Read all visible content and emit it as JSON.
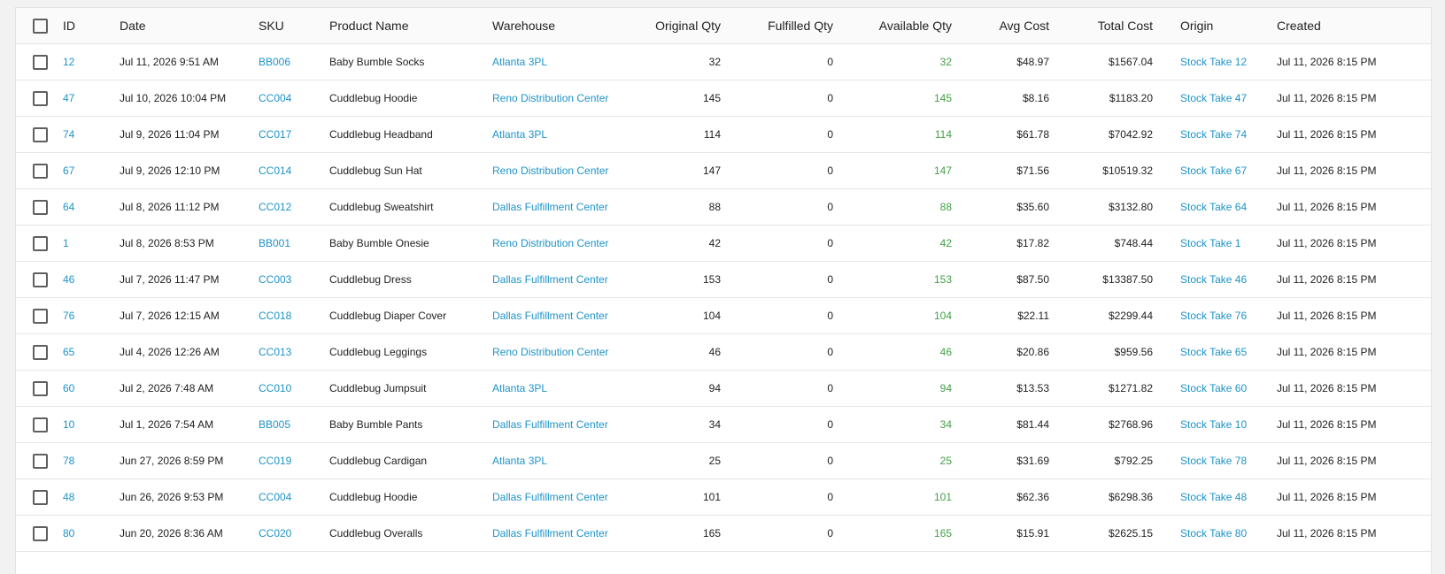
{
  "columns": {
    "id": "ID",
    "date": "Date",
    "sku": "SKU",
    "product": "Product Name",
    "warehouse": "Warehouse",
    "original": "Original Qty",
    "fulfilled": "Fulfilled Qty",
    "available": "Available Qty",
    "avg_cost": "Avg Cost",
    "total_cost": "Total Cost",
    "origin": "Origin",
    "created": "Created"
  },
  "rows": [
    {
      "id": "12",
      "date": "Jul 11, 2026 9:51 AM",
      "sku": "BB006",
      "product": "Baby Bumble Socks",
      "warehouse": "Atlanta 3PL",
      "original": "32",
      "fulfilled": "0",
      "available": "32",
      "avg_cost": "$48.97",
      "total_cost": "$1567.04",
      "origin": "Stock Take 12",
      "created": "Jul 11, 2026 8:15 PM"
    },
    {
      "id": "47",
      "date": "Jul 10, 2026 10:04 PM",
      "sku": "CC004",
      "product": "Cuddlebug Hoodie",
      "warehouse": "Reno Distribution Center",
      "original": "145",
      "fulfilled": "0",
      "available": "145",
      "avg_cost": "$8.16",
      "total_cost": "$1183.20",
      "origin": "Stock Take 47",
      "created": "Jul 11, 2026 8:15 PM"
    },
    {
      "id": "74",
      "date": "Jul 9, 2026 11:04 PM",
      "sku": "CC017",
      "product": "Cuddlebug Headband",
      "warehouse": "Atlanta 3PL",
      "original": "114",
      "fulfilled": "0",
      "available": "114",
      "avg_cost": "$61.78",
      "total_cost": "$7042.92",
      "origin": "Stock Take 74",
      "created": "Jul 11, 2026 8:15 PM"
    },
    {
      "id": "67",
      "date": "Jul 9, 2026 12:10 PM",
      "sku": "CC014",
      "product": "Cuddlebug Sun Hat",
      "warehouse": "Reno Distribution Center",
      "original": "147",
      "fulfilled": "0",
      "available": "147",
      "avg_cost": "$71.56",
      "total_cost": "$10519.32",
      "origin": "Stock Take 67",
      "created": "Jul 11, 2026 8:15 PM"
    },
    {
      "id": "64",
      "date": "Jul 8, 2026 11:12 PM",
      "sku": "CC012",
      "product": "Cuddlebug Sweatshirt",
      "warehouse": "Dallas Fulfillment Center",
      "original": "88",
      "fulfilled": "0",
      "available": "88",
      "avg_cost": "$35.60",
      "total_cost": "$3132.80",
      "origin": "Stock Take 64",
      "created": "Jul 11, 2026 8:15 PM"
    },
    {
      "id": "1",
      "date": "Jul 8, 2026 8:53 PM",
      "sku": "BB001",
      "product": "Baby Bumble Onesie",
      "warehouse": "Reno Distribution Center",
      "original": "42",
      "fulfilled": "0",
      "available": "42",
      "avg_cost": "$17.82",
      "total_cost": "$748.44",
      "origin": "Stock Take 1",
      "created": "Jul 11, 2026 8:15 PM"
    },
    {
      "id": "46",
      "date": "Jul 7, 2026 11:47 PM",
      "sku": "CC003",
      "product": "Cuddlebug Dress",
      "warehouse": "Dallas Fulfillment Center",
      "original": "153",
      "fulfilled": "0",
      "available": "153",
      "avg_cost": "$87.50",
      "total_cost": "$13387.50",
      "origin": "Stock Take 46",
      "created": "Jul 11, 2026 8:15 PM"
    },
    {
      "id": "76",
      "date": "Jul 7, 2026 12:15 AM",
      "sku": "CC018",
      "product": "Cuddlebug Diaper Cover",
      "warehouse": "Dallas Fulfillment Center",
      "original": "104",
      "fulfilled": "0",
      "available": "104",
      "avg_cost": "$22.11",
      "total_cost": "$2299.44",
      "origin": "Stock Take 76",
      "created": "Jul 11, 2026 8:15 PM"
    },
    {
      "id": "65",
      "date": "Jul 4, 2026 12:26 AM",
      "sku": "CC013",
      "product": "Cuddlebug Leggings",
      "warehouse": "Reno Distribution Center",
      "original": "46",
      "fulfilled": "0",
      "available": "46",
      "avg_cost": "$20.86",
      "total_cost": "$959.56",
      "origin": "Stock Take 65",
      "created": "Jul 11, 2026 8:15 PM"
    },
    {
      "id": "60",
      "date": "Jul 2, 2026 7:48 AM",
      "sku": "CC010",
      "product": "Cuddlebug Jumpsuit",
      "warehouse": "Atlanta 3PL",
      "original": "94",
      "fulfilled": "0",
      "available": "94",
      "avg_cost": "$13.53",
      "total_cost": "$1271.82",
      "origin": "Stock Take 60",
      "created": "Jul 11, 2026 8:15 PM"
    },
    {
      "id": "10",
      "date": "Jul 1, 2026 7:54 AM",
      "sku": "BB005",
      "product": "Baby Bumble Pants",
      "warehouse": "Dallas Fulfillment Center",
      "original": "34",
      "fulfilled": "0",
      "available": "34",
      "avg_cost": "$81.44",
      "total_cost": "$2768.96",
      "origin": "Stock Take 10",
      "created": "Jul 11, 2026 8:15 PM"
    },
    {
      "id": "78",
      "date": "Jun 27, 2026 8:59 PM",
      "sku": "CC019",
      "product": "Cuddlebug Cardigan",
      "warehouse": "Atlanta 3PL",
      "original": "25",
      "fulfilled": "0",
      "available": "25",
      "avg_cost": "$31.69",
      "total_cost": "$792.25",
      "origin": "Stock Take 78",
      "created": "Jul 11, 2026 8:15 PM"
    },
    {
      "id": "48",
      "date": "Jun 26, 2026 9:53 PM",
      "sku": "CC004",
      "product": "Cuddlebug Hoodie",
      "warehouse": "Dallas Fulfillment Center",
      "original": "101",
      "fulfilled": "0",
      "available": "101",
      "avg_cost": "$62.36",
      "total_cost": "$6298.36",
      "origin": "Stock Take 48",
      "created": "Jul 11, 2026 8:15 PM"
    },
    {
      "id": "80",
      "date": "Jun 20, 2026 8:36 AM",
      "sku": "CC020",
      "product": "Cuddlebug Overalls",
      "warehouse": "Dallas Fulfillment Center",
      "original": "165",
      "fulfilled": "0",
      "available": "165",
      "avg_cost": "$15.91",
      "total_cost": "$2625.15",
      "origin": "Stock Take 80",
      "created": "Jul 11, 2026 8:15 PM"
    }
  ],
  "colors": {
    "link": "#1e93c7",
    "available_qty": "#43a047",
    "header_bg": "#fafafa",
    "row_border": "#e6e6e6"
  },
  "icons": {
    "row_select": "checkbox-icon",
    "select_all": "checkbox-icon"
  }
}
